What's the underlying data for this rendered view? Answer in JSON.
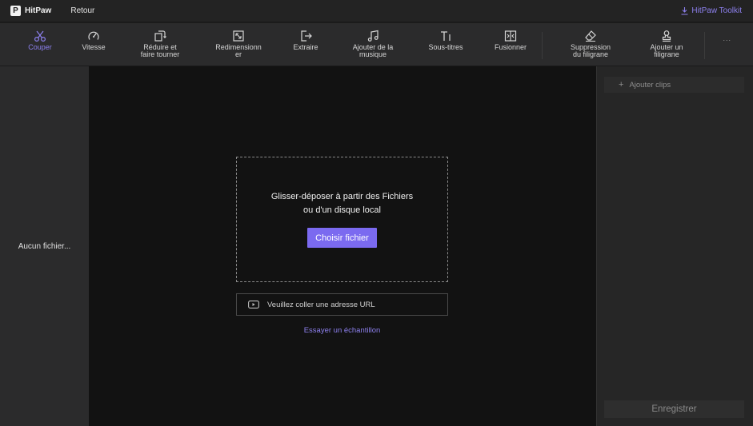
{
  "app": {
    "name": "HitPaw",
    "back_label": "Retour",
    "toolkit_label": "HitPaw Toolkit"
  },
  "toolbar": {
    "tools": [
      {
        "label": "Couper",
        "icon": "scissors-icon"
      },
      {
        "label": "Vitesse",
        "icon": "speedometer-icon"
      },
      {
        "label": "Réduire et\nfaire tourner",
        "icon": "crop-rotate-icon"
      },
      {
        "label": "Redimensionn\ner",
        "icon": "resize-icon"
      },
      {
        "label": "Extraire",
        "icon": "export-icon"
      },
      {
        "label": "Ajouter de la\nmusique",
        "icon": "music-note-icon"
      },
      {
        "label": "Sous-titres",
        "icon": "text-icon"
      },
      {
        "label": "Fusionner",
        "icon": "merge-icon"
      },
      {
        "label": "Suppression\ndu filigrane",
        "icon": "eraser-icon"
      },
      {
        "label": "Ajouter un\nfiligrane",
        "icon": "stamp-icon"
      }
    ],
    "more": "..."
  },
  "left_panel": {
    "empty_text": "Aucun fichier..."
  },
  "dropzone": {
    "line1": "Glisser-déposer à partir des Fichiers",
    "line2": "ou d'un disque local",
    "button": "Choisir fichier"
  },
  "url_input": {
    "placeholder": "Veuillez coller une adresse URL"
  },
  "sample_link": "Essayer un échantillon",
  "right_panel": {
    "add_clips": "Ajouter clips",
    "save": "Enregistrer"
  },
  "colors": {
    "accent": "#7b6af0",
    "accent_text": "#8d80ee",
    "background": "#121212",
    "panel": "#2b2b2c"
  }
}
